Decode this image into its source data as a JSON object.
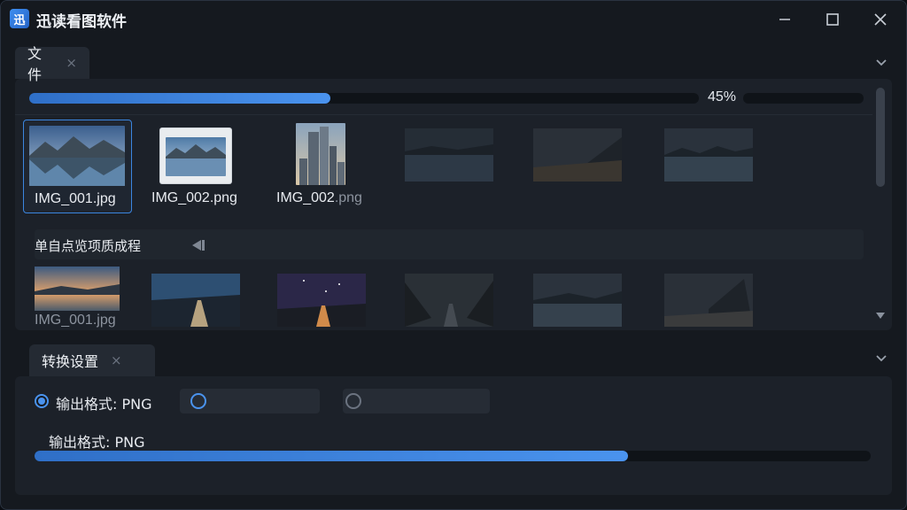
{
  "app": {
    "title": "迅读看图软件",
    "logo_glyph": "迅"
  },
  "window_controls": {
    "minimize": "minimize-icon",
    "maximize": "maximize-icon",
    "close": "close-icon"
  },
  "files": {
    "tab_label": "文件",
    "tab_close": "×",
    "progress": {
      "percent": 45,
      "text": "45%"
    },
    "thumbnails_row1": [
      {
        "label": "IMG_001.jpg",
        "selected": true
      },
      {
        "label": "IMG_002.png",
        "selected": false
      },
      {
        "label_main": "IMG_002",
        "label_dim": ".png",
        "selected": false
      },
      {
        "label": "",
        "selected": false
      },
      {
        "label": "",
        "selected": false
      },
      {
        "label": "",
        "selected": false
      }
    ],
    "thumbnails_row2": [
      {
        "label": "IMG_001.jpg"
      },
      {
        "label": ""
      },
      {
        "label": ""
      },
      {
        "label": ""
      },
      {
        "label": ""
      },
      {
        "label": ""
      }
    ],
    "overlay_text": "单自点览项质成程"
  },
  "convert": {
    "tab_label": "转换设置",
    "tab_close": "×",
    "output_format_label": "输出格式:",
    "output_format_value": "PNG",
    "output_format_line": "输出格式: PNG",
    "progress_percent": 71
  },
  "colors": {
    "accent": "#4a93ee",
    "background": "#15191f",
    "panel": "#1c2129"
  }
}
